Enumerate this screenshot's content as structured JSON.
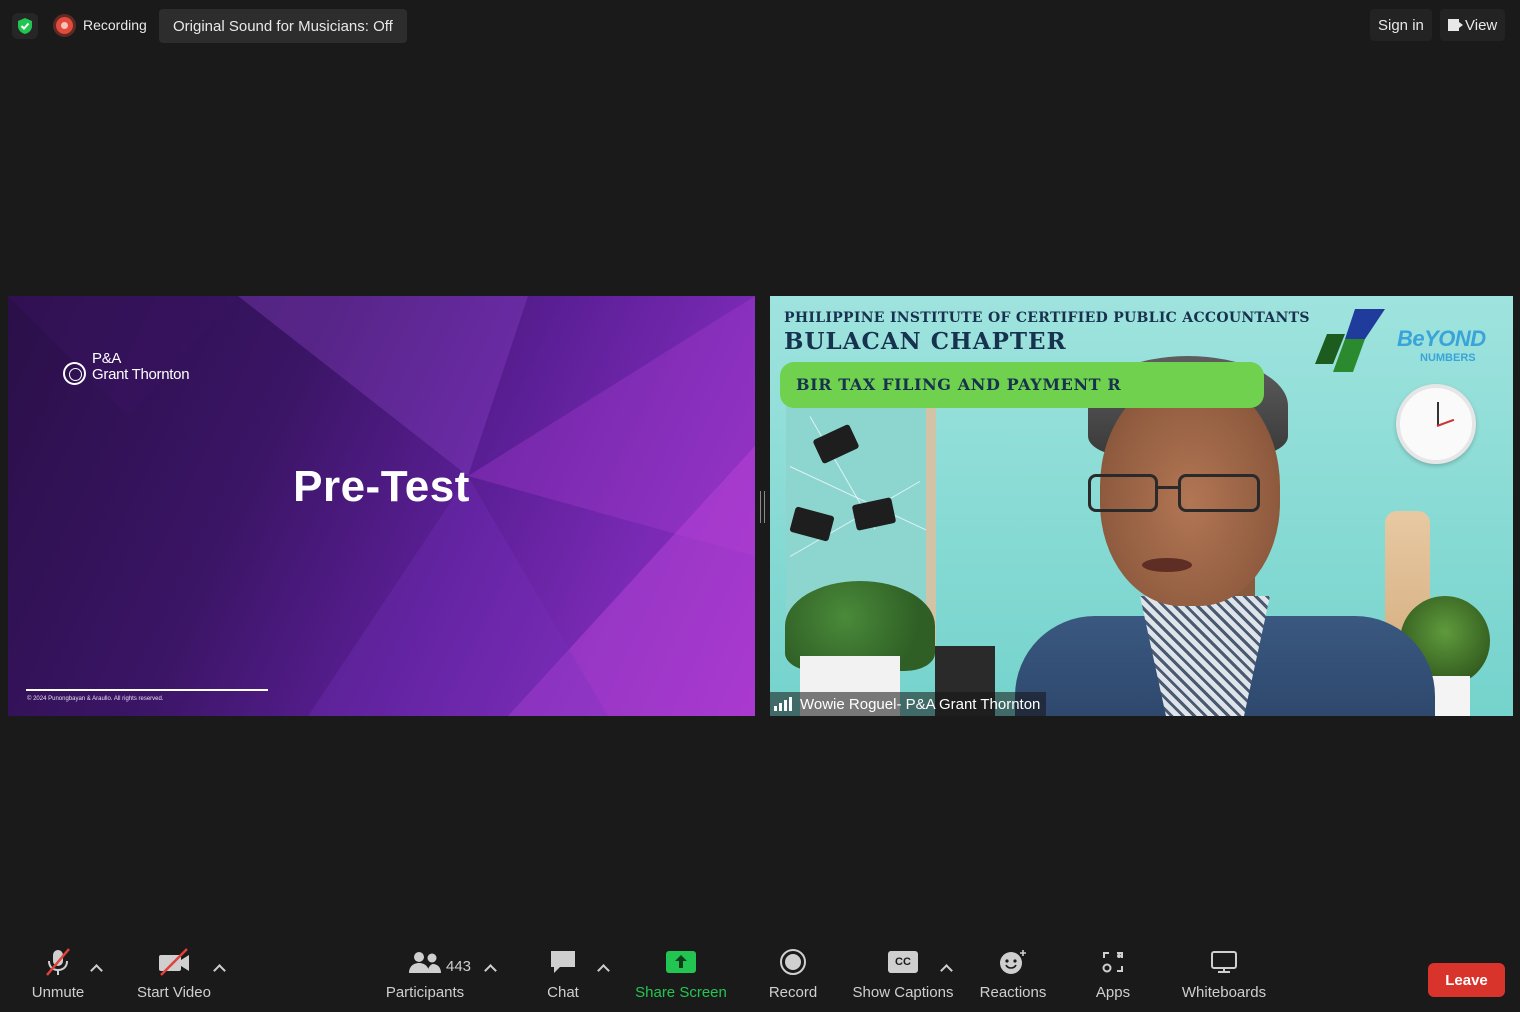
{
  "topbar": {
    "security_icon": "shield-check-icon",
    "recording_label": "Recording",
    "original_sound_label": "Original Sound for Musicians: Off",
    "sign_in_label": "Sign in",
    "view_label": "View"
  },
  "slide": {
    "logo_line1": "P&A",
    "logo_line2": "Grant Thornton",
    "title": "Pre-Test",
    "copyright": "© 2024 Punongbayan & Araullo. All rights reserved."
  },
  "video": {
    "org_line": "PHILIPPINE INSTITUTE OF CERTIFIED PUBLIC ACCOUNTANTS",
    "chapter": "BULACAN CHAPTER",
    "topic": "BIR TAX FILING AND PAYMENT R",
    "logo_word": "BeYOND",
    "logo_sub": "NUMBERS",
    "participant_name": "Wowie Roguel- P&A Grant Thornton"
  },
  "toolbar": {
    "unmute": "Unmute",
    "start_video": "Start Video",
    "participants": "Participants",
    "participants_count": "443",
    "chat": "Chat",
    "share_screen": "Share Screen",
    "record": "Record",
    "show_captions": "Show Captions",
    "cc_badge": "CC",
    "reactions": "Reactions",
    "apps": "Apps",
    "whiteboards": "Whiteboards",
    "leave": "Leave"
  },
  "colors": {
    "background": "#1a1a1a",
    "share_green": "#23c552",
    "leave_red": "#d9342b",
    "recording_red": "#e24a3b",
    "slide_purple": "#5c1f97"
  }
}
